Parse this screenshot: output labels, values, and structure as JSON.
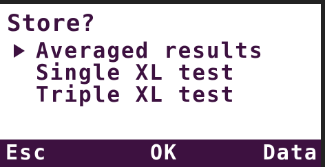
{
  "prompt": "Store?",
  "menu": {
    "items": [
      {
        "label": "Averaged results",
        "selected": true
      },
      {
        "label": "Single XL test",
        "selected": false
      },
      {
        "label": "Triple XL test",
        "selected": false
      }
    ]
  },
  "softkeys": {
    "left": "Esc",
    "center": "OK",
    "right": "Data"
  },
  "colors": {
    "text": "#3d1140",
    "softkey_bar": "#3d1140",
    "background": "#ffffff"
  },
  "icons": {
    "selection_cursor": "triangle-right-icon"
  }
}
